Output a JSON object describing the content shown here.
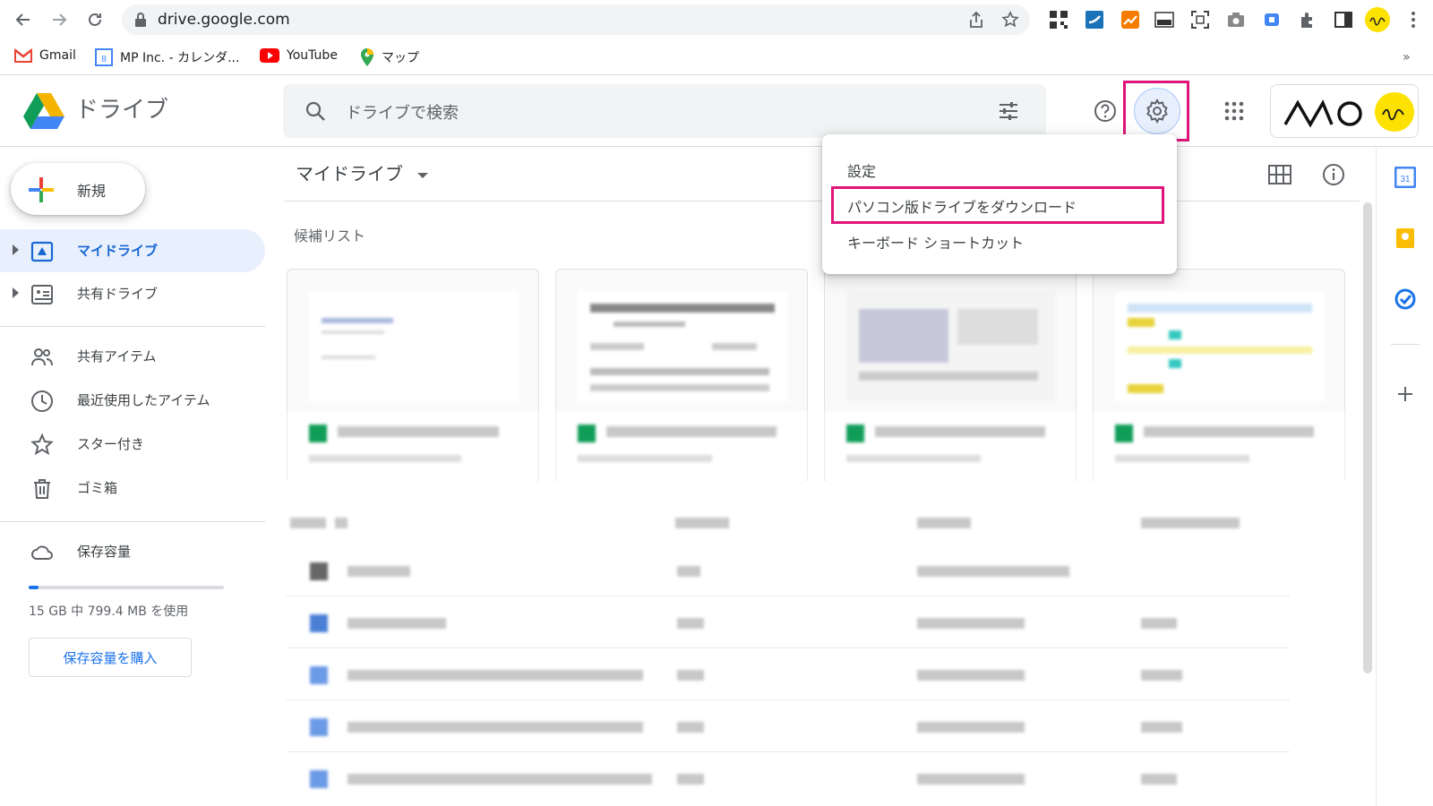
{
  "browser": {
    "url": "drive.google.com",
    "bookmarks": [
      {
        "label": "Gmail"
      },
      {
        "label": "MP Inc. - カレンダ..."
      },
      {
        "label": "YouTube"
      },
      {
        "label": "マップ"
      }
    ]
  },
  "drive": {
    "app_title": "ドライブ",
    "search_placeholder": "ドライブで検索",
    "new_label": "新規",
    "nav": [
      {
        "label": "マイドライブ"
      },
      {
        "label": "共有ドライブ"
      },
      {
        "label": "共有アイテム"
      },
      {
        "label": "最近使用したアイテム"
      },
      {
        "label": "スター付き"
      },
      {
        "label": "ゴミ箱"
      },
      {
        "label": "保存容量"
      }
    ],
    "storage_text": "15 GB 中 799.4 MB を使用",
    "storage_used_fraction": 0.05,
    "buy_storage_label": "保存容量を購入",
    "main_title": "マイドライブ",
    "suggested_label": "候補リスト",
    "settings_menu": {
      "header": "設定",
      "items": [
        {
          "label": "パソコン版ドライブをダウンロード"
        },
        {
          "label": "キーボード ショートカット"
        }
      ]
    }
  },
  "colors": {
    "highlight": "#e0147a",
    "active_bg": "#e8f0fe",
    "active_text": "#1967d2",
    "drive_blue": "#4285f4",
    "drive_green": "#0f9d58",
    "drive_yellow": "#f4b400"
  }
}
